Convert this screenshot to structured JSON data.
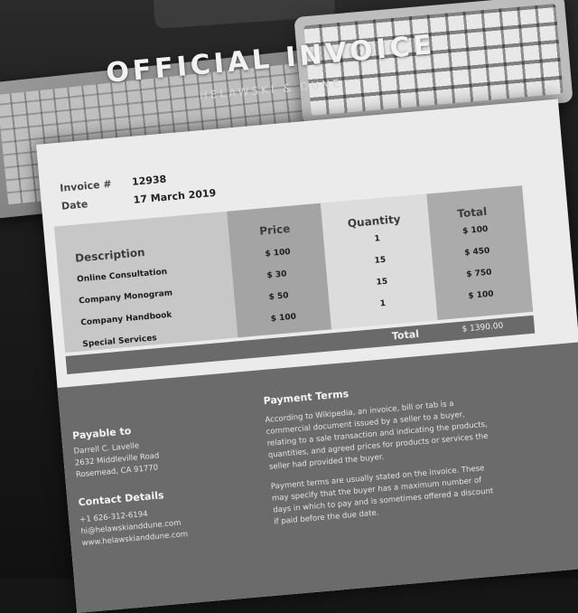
{
  "hero": {
    "title": "OFFICIAL INVOICE",
    "subtitle": "HELAWSKI & DUNE"
  },
  "invoice": {
    "number_label": "Invoice #",
    "number": "12938",
    "date_label": "Date",
    "date": "17 March 2019"
  },
  "table": {
    "headers": {
      "description": "Description",
      "price": "Price",
      "quantity": "Quantity",
      "total": "Total"
    },
    "rows": [
      {
        "description": "Online Consultation",
        "price": "$ 100",
        "quantity": "1",
        "total": "$ 100"
      },
      {
        "description": "Company Monogram",
        "price": "$ 30",
        "quantity": "15",
        "total": "$ 450"
      },
      {
        "description": "Company Handbook",
        "price": "$ 50",
        "quantity": "15",
        "total": "$ 750"
      },
      {
        "description": "Special Services",
        "price": "$ 100",
        "quantity": "1",
        "total": "$ 100"
      }
    ],
    "grand_total_label": "Total",
    "grand_total": "$ 1390.00"
  },
  "payable_to": {
    "heading": "Payable to",
    "name": "Darrell C. Lavelle",
    "street": "2632 Middleville Road",
    "city": "Rosemead, CA 91770"
  },
  "contact": {
    "heading": "Contact Details",
    "phone": "+1 626-312-6194",
    "email": "hi@helawskianddune.com",
    "website": "www.helawskianddune.com"
  },
  "payment_terms": {
    "heading": "Payment Terms",
    "paragraph1_lines": [
      "According to Wikipedia, an invoice, bill or tab is a",
      "commercial document issued by a seller to a buyer,",
      "relating to a sale transaction and indicating the products,",
      "quantities, and agreed prices for products or services the",
      "seller had provided the buyer."
    ],
    "paragraph2_lines": [
      "Payment terms are usually stated on the invoice. These",
      "may specify that the buyer has a maximum number of",
      "days in which to pay and is sometimes offered a discount",
      "if paid before the due date."
    ]
  }
}
